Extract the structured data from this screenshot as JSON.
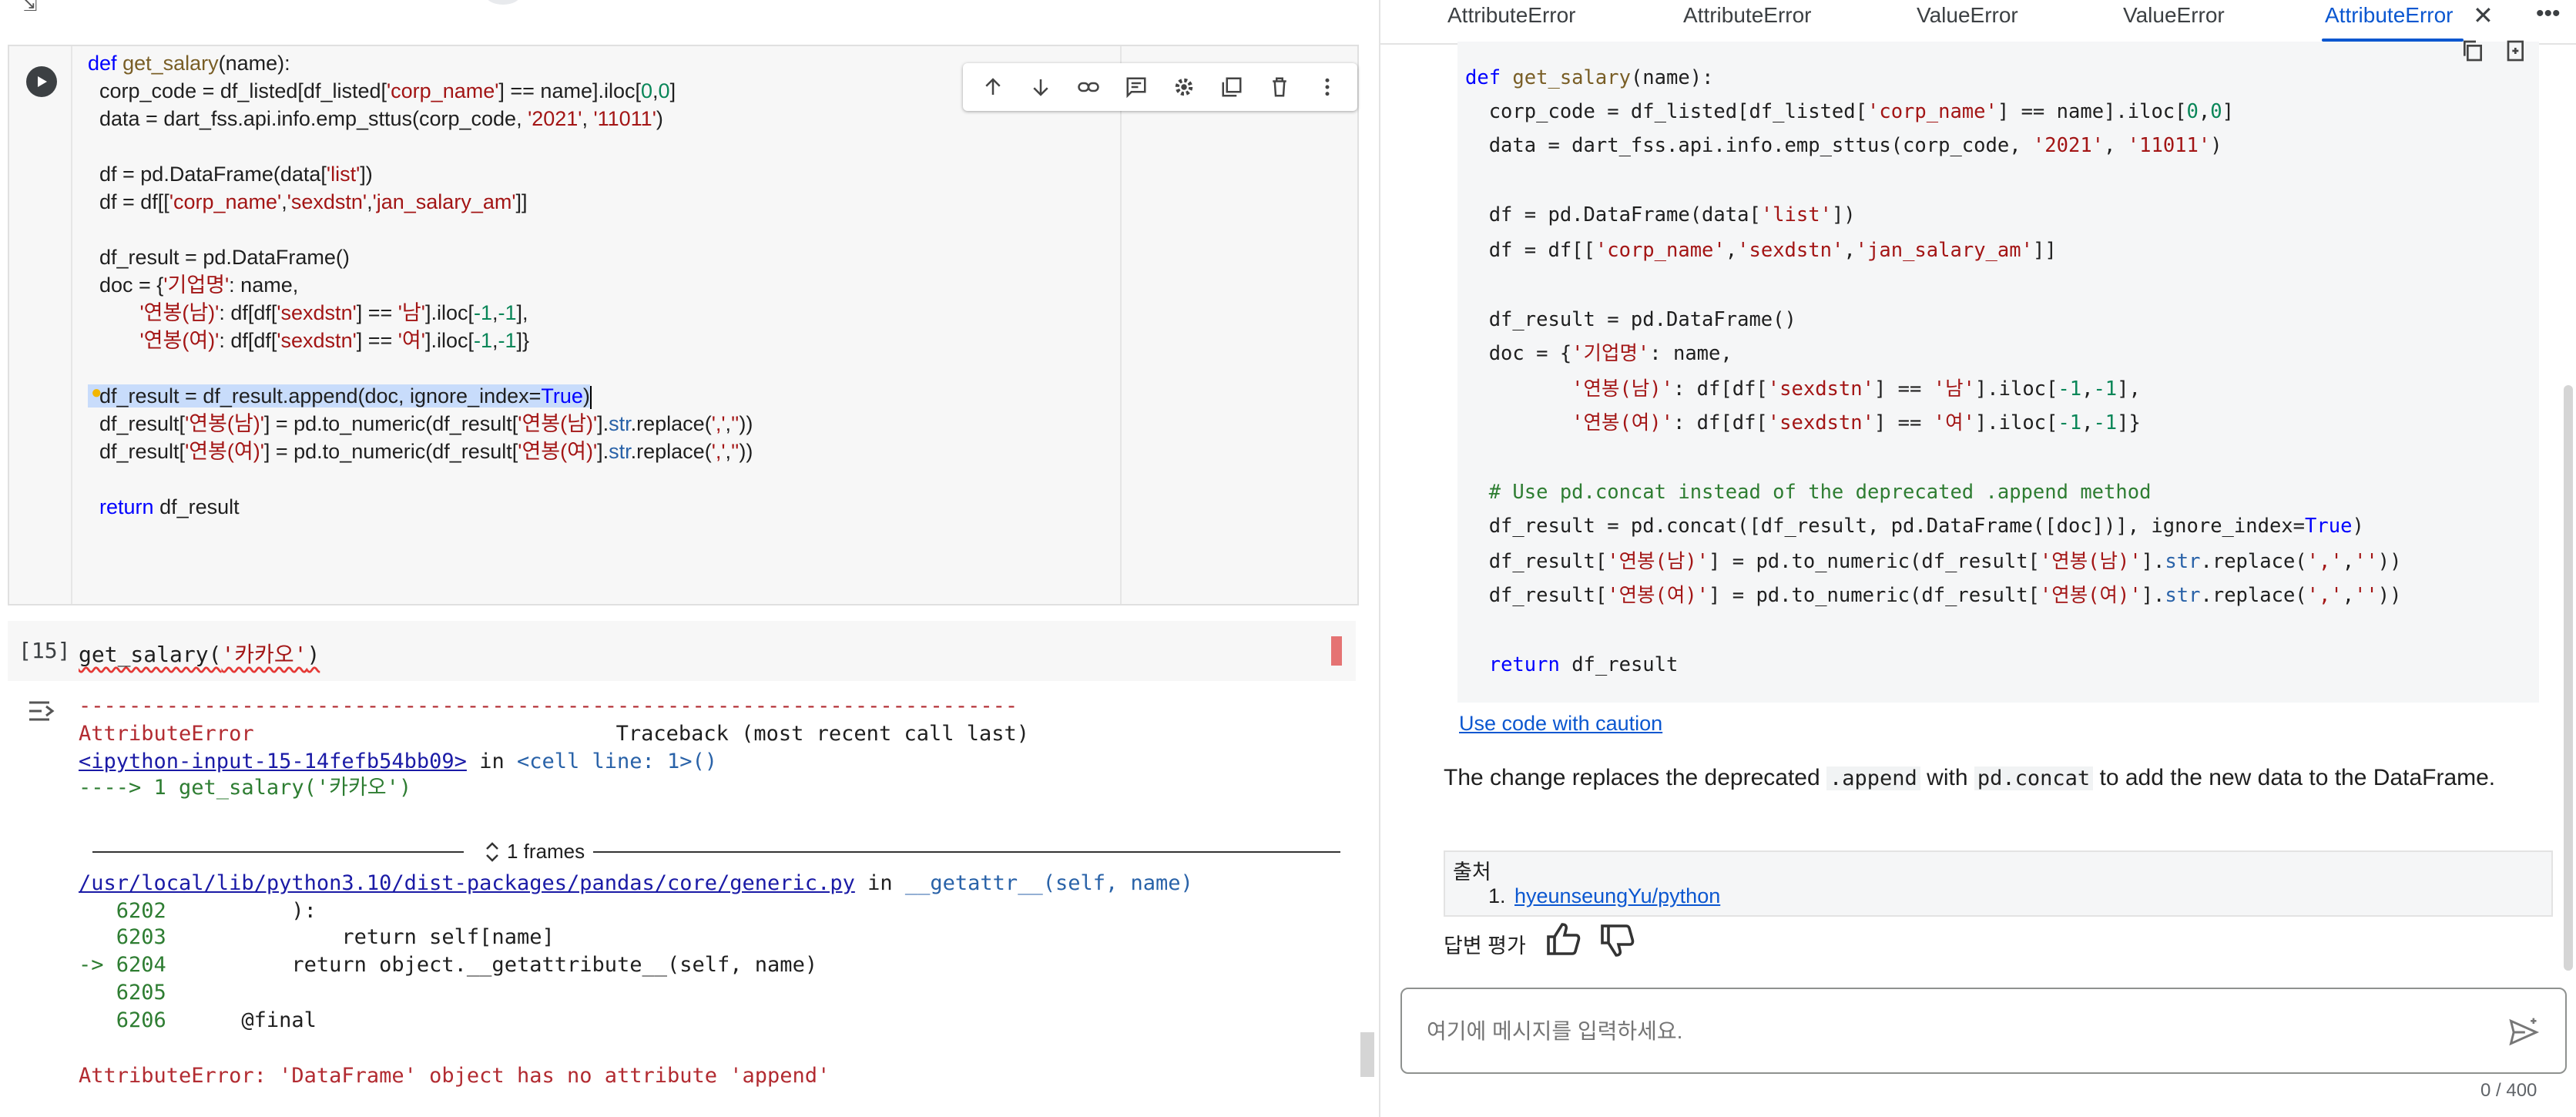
{
  "notebook": {
    "code_cell": {
      "lines": [
        "def get_salary(name):",
        "  corp_code = df_listed[df_listed['corp_name'] == name].iloc[0,0]",
        "  data = dart_fss.api.info.emp_sttus(corp_code, '2021', '11011')",
        "",
        "  df = pd.DataFrame(data['list'])",
        "  df = df[['corp_name','sexdstn','jan_salary_am']]",
        "",
        "  df_result = pd.DataFrame()",
        "  doc = {'기업명': name,",
        "         '연봉(남)': df[df['sexdstn'] == '남'].iloc[-1,-1],",
        "         '연봉(여)': df[df['sexdstn'] == '여'].iloc[-1,-1]}",
        "",
        "  df_result = df_result.append(doc, ignore_index=True)",
        "  df_result['연봉(남)'] = pd.to_numeric(df_result['연봉(남)'].str.replace(',',''))",
        "  df_result['연봉(여)'] = pd.to_numeric(df_result['연봉(여)'].str.replace(',',''))",
        "",
        "  return df_result"
      ],
      "toolbar_icons": [
        "arrow-up-icon",
        "arrow-down-icon",
        "link-icon",
        "comment-icon",
        "gear-icon",
        "mirror-cell-icon",
        "delete-icon",
        "more-vert-icon"
      ]
    },
    "call_cell": {
      "count": "[15]",
      "code_prefix": "get_salary(",
      "code_arg": "'카카오'",
      "code_suffix": ")"
    },
    "output": {
      "dash_rule": "---------------------------------------------------------------------------",
      "error_name": "AttributeError",
      "traceback_label": "Traceback (most recent call last)",
      "input_link": "<ipython-input-15-14fefb54bb09>",
      "in_word": "in",
      "cell_line": "<cell line: 1>()",
      "arrow_line": "----> 1 get_salary('카카오')",
      "frames_label": "1 frames",
      "file_link": "/usr/local/lib/python3.10/dist-packages/pandas/core/generic.py",
      "func_name": "__getattr__(self, name)",
      "code_lines": [
        {
          "num": "   6202",
          "code": "          ):"
        },
        {
          "num": "   6203",
          "code": "              return self[name]"
        },
        {
          "num": "-> 6204",
          "code": "          return object.__getattribute__(self, name)"
        },
        {
          "num": "   6205",
          "code": ""
        },
        {
          "num": "   6206",
          "code": "      @final"
        }
      ],
      "final_error": "AttributeError: 'DataFrame' object has no attribute 'append'"
    }
  },
  "panel": {
    "tabs": [
      "AttributeError",
      "AttributeError",
      "ValueError",
      "ValueError",
      "AttributeError"
    ],
    "close_label": "✕",
    "more_label": "•••",
    "code_lines": [
      "def get_salary(name):",
      "  corp_code = df_listed[df_listed['corp_name'] == name].iloc[0,0]",
      "  data = dart_fss.api.info.emp_sttus(corp_code, '2021', '11011')",
      "",
      "  df = pd.DataFrame(data['list'])",
      "  df = df[['corp_name','sexdstn','jan_salary_am']]",
      "",
      "  df_result = pd.DataFrame()",
      "  doc = {'기업명': name,",
      "         '연봉(남)': df[df['sexdstn'] == '남'].iloc[-1,-1],",
      "         '연봉(여)': df[df['sexdstn'] == '여'].iloc[-1,-1]}",
      "",
      "  # Use pd.concat instead of the deprecated .append method",
      "  df_result = pd.concat([df_result, pd.DataFrame([doc])], ignore_index=True)",
      "  df_result['연봉(남)'] = pd.to_numeric(df_result['연봉(남)'].str.replace(',',''))",
      "  df_result['연봉(여)'] = pd.to_numeric(df_result['연봉(여)'].str.replace(',',''))",
      "",
      "  return df_result"
    ],
    "caution_link": "Use code with caution",
    "explanation_parts": {
      "p1": "The change replaces the deprecated ",
      "c1": ".append",
      "p2": " with ",
      "c2": "pd.concat",
      "p3": " to add the new data to the DataFrame."
    },
    "sources_title": "출처",
    "sources": [
      {
        "num": "1.",
        "label": "hyeunseungYu/python"
      }
    ],
    "rate_label": "답변 평가",
    "input_placeholder": "여기에 메시지를 입력하세요.",
    "char_counter": "0 / 400"
  }
}
